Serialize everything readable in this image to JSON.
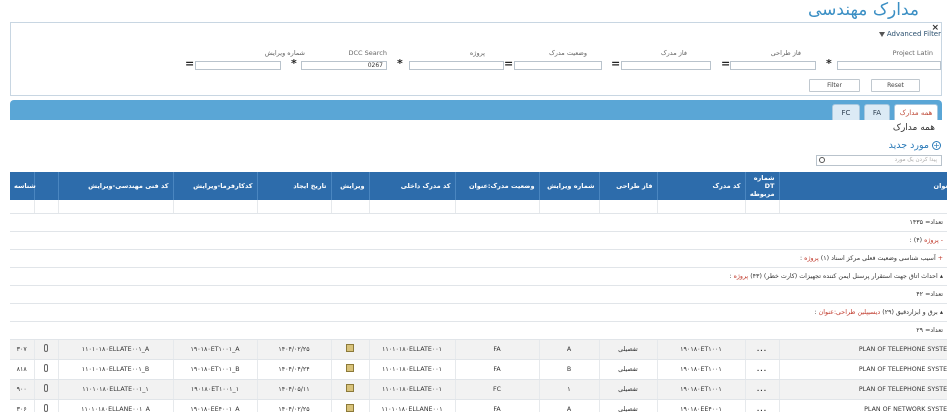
{
  "page_title": "مدارک مهندسی",
  "filter": {
    "title": "Advanced Filter",
    "close": "×",
    "fields": [
      {
        "label": "Project Latin",
        "value": "",
        "op": "*"
      },
      {
        "label": "فاز طراحی",
        "value": "",
        "op": "="
      },
      {
        "label": "فاز مدرک",
        "value": "",
        "op": "="
      },
      {
        "label": "وضعیت مدرک",
        "value": "",
        "op": "="
      },
      {
        "label": "پروژه",
        "value": "",
        "op": "*"
      },
      {
        "label": "DCC Search",
        "value": "0267",
        "op": "*"
      },
      {
        "label": "شماره ویرایش",
        "value": "",
        "op": "="
      }
    ],
    "filter_btn": "Filter",
    "reset_btn": "Reset"
  },
  "tabs": [
    {
      "label": "همه مدارک"
    },
    {
      "label": "FA"
    },
    {
      "label": "FC"
    }
  ],
  "section_title": "همه مدارک",
  "new_item": "مورد جدید",
  "search": {
    "placeholder": "پیدا کردن یک مورد"
  },
  "columns": {
    "title": "عنوان",
    "dt_no": "شماره DT مربوطه",
    "doc_code": "کد مدرک",
    "design_phase": "فاز طراحی",
    "revision_no": "شماره ویرایش",
    "status_title": "وضعیت مدرک:عنوان",
    "internal_code": "کد مدرک داخلی",
    "edit": "ویرایش",
    "created": "تاریخ ایجاد",
    "contractor_code": "کدکارفرما-ویرایش",
    "tech_code": "کد فنی مهندسی-ویرایش",
    "id": "شناسه"
  },
  "groups": {
    "count1": "تعداد= ۱۴۳۵",
    "project_label": "پروژه",
    "project_count": ": (۴)",
    "g1_label": "پروژه",
    "g1_text": ": آسیب شناسی وضعیت فعلی مرکز اسناد (۱)",
    "g2_label": "پروژه",
    "g2_text": ": احداث اتاق جهت استقرار پرسنل ایمن کننده تجهیزات (کارت خطر) (۴۳)",
    "count2": "تعداد= ۴۲",
    "disc_label": "دیسیپلین طراحی:عنوان",
    "disc_text": ": برق و ابزاردقیق (۲۹)",
    "count3": "تعداد= ۲۹"
  },
  "rows": [
    {
      "title": "PLAN OF TELEPHONE SYSTEM",
      "dots": "...",
      "doc_code": "۱۹۰۱۸۰ET۱۰۰۱",
      "phase": "تفصیلی",
      "rev": "A",
      "status": "FA",
      "internal": "۱۱۰۱۰۱۸۰ELLATE۰۰۱",
      "created": "۱۴۰۴/۰۲/۲۵",
      "contractor": "۱۹۰۱۸۰ET۱۰۰۱_A",
      "tech": "۱۱۰۱۰۱۸۰ELLATE۰۰۱_A",
      "id": "۳۰۷"
    },
    {
      "title": "PLAN OF TELEPHONE SYSTEM",
      "dots": "...",
      "doc_code": "۱۹۰۱۸۰ET۱۰۰۱",
      "phase": "تفصیلی",
      "rev": "B",
      "status": "FA",
      "internal": "۱۱۰۱۰۱۸۰ELLATE۰۰۱",
      "created": "۱۴۰۴/۰۴/۲۴",
      "contractor": "۱۹۰۱۸۰ET۱۰۰۱_B",
      "tech": "۱۱۰۱۰۱۸۰ELLATE۰۰۱_B",
      "id": "۸۱۸"
    },
    {
      "title": "PLAN OF TELEPHONE SYSTEM",
      "dots": "...",
      "doc_code": "۱۹۰۱۸۰ET۱۰۰۱",
      "phase": "تفصیلی",
      "rev": "۱",
      "status": "FC",
      "internal": "۱۱۰۱۰۱۸۰ELLATE۰۰۱",
      "created": "۱۴۰۴/۰۵/۱۱",
      "contractor": "۱۹۰۱۸۰ET۱۰۰۱_۱",
      "tech": "۱۱۰۱۰۱۸۰ELLATE۰۰۱_۱",
      "id": "۹۰۰"
    },
    {
      "title": "PLAN OF NETWORK SYSTEM",
      "dots": "...",
      "doc_code": "۱۹۰۱۸۰EE۴۰۰۱",
      "phase": "تفصیلی",
      "rev": "A",
      "status": "FA",
      "internal": "۱۱۰۱۰۱۸۰ELLANE۰۰۱",
      "created": "۱۴۰۴/۰۲/۲۵",
      "contractor": "۱۹۰۱۸۰EE۴۰۰۱_A",
      "tech": "۱۱۰۱۰۱۸۰ELLANE۰۰۱_A",
      "id": "۳۰۶"
    }
  ]
}
